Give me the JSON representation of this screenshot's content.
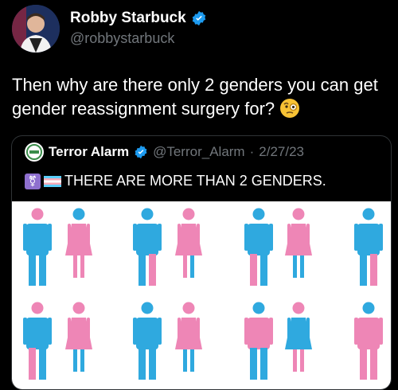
{
  "post": {
    "author_name": "Robby Starbuck",
    "author_handle": "@robbystarbuck",
    "text": "Then why are there only 2 genders you can get gender reassignment surgery for?",
    "emoji": "face-with-monocle"
  },
  "quoted": {
    "author_name": "Terror Alarm",
    "author_handle": "@Terror_Alarm",
    "separator": "·",
    "date": "2/27/23",
    "text": "THERE ARE MORE THAN 2 GENDERS.",
    "icons": [
      "transgender-symbol-icon",
      "transgender-flag-icon"
    ]
  },
  "colors": {
    "blue": "#2fa9df",
    "pink": "#ee86b6",
    "verified": "#1d9bf0",
    "background": "#000000"
  }
}
